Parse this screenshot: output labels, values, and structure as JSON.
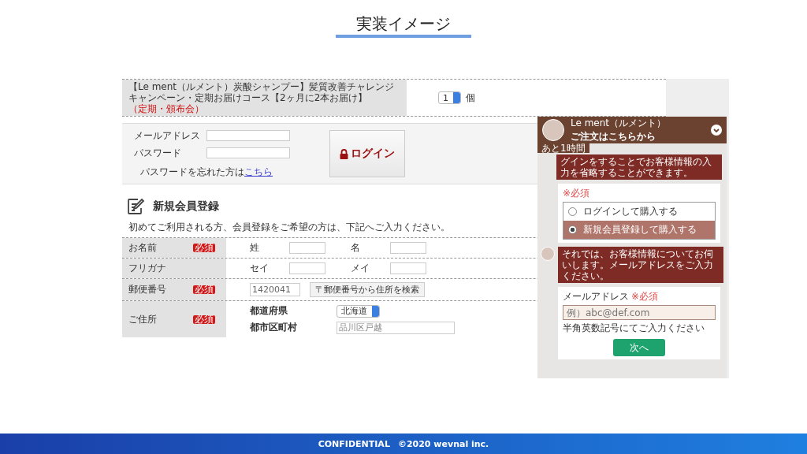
{
  "slide": {
    "title": "実装イメージ",
    "footer_left": "CONFIDENTIAL",
    "footer_right": "©2020 wevnal inc."
  },
  "product": {
    "name": "【Le ment（ルメント）炭酸シャンプー】髪質改善チャレンジキャンペーン・定期お届けコース【2ヶ月に2本お届け】",
    "note": "（定期・頒布会）",
    "quantity": "1",
    "unit": "個"
  },
  "login": {
    "fields": [
      {
        "label": "メールアドレス"
      },
      {
        "label": "パスワード"
      }
    ],
    "forgot_text": "パスワードを忘れた方は",
    "forgot_link": "こちら",
    "button": "ログイン"
  },
  "registration": {
    "title": "新規会員登録",
    "intro": "初めてご利用される方、会員登録をご希望の方は、下記へご入力ください。",
    "rows": [
      {
        "label": "お名前",
        "badge": "必須",
        "kind": "pair",
        "fields": [
          {
            "label": "姓"
          },
          {
            "label": "名"
          }
        ]
      },
      {
        "label": "フリガナ",
        "kind": "pair",
        "fields": [
          {
            "label": "セイ"
          },
          {
            "label": "メイ"
          }
        ]
      },
      {
        "label": "郵便番号",
        "badge": "必須",
        "kind": "postal",
        "value": "1420041",
        "button": "〒郵便番号から住所を検索"
      },
      {
        "label": "ご住所",
        "badge": "必須",
        "kind": "address",
        "prefecture_label": "都道府県",
        "prefecture": "北海道",
        "city_label": "都市区町村",
        "city_value": "品川区戸越"
      }
    ]
  },
  "chat": {
    "brand": "Le ment（ルメント）",
    "title": "ご注文はこちらから",
    "timer": "あと1時間",
    "message_1": "グインをすることでお客様情報の入力を省略することができます。",
    "required_note": "※必須",
    "options": [
      {
        "label": "ログインして購入する",
        "selected": false
      },
      {
        "label": "新規会員登録して購入する",
        "selected": true
      }
    ],
    "message_2": "それでは、お客様情報についてお伺いします。メールアドレスをご入力ください。",
    "email_label": "メールアドレス",
    "email_required": "※必須",
    "email_placeholder": "例）abc@def.com",
    "email_hint": "半角英数記号にてご入力ください",
    "next_button": "次へ"
  }
}
